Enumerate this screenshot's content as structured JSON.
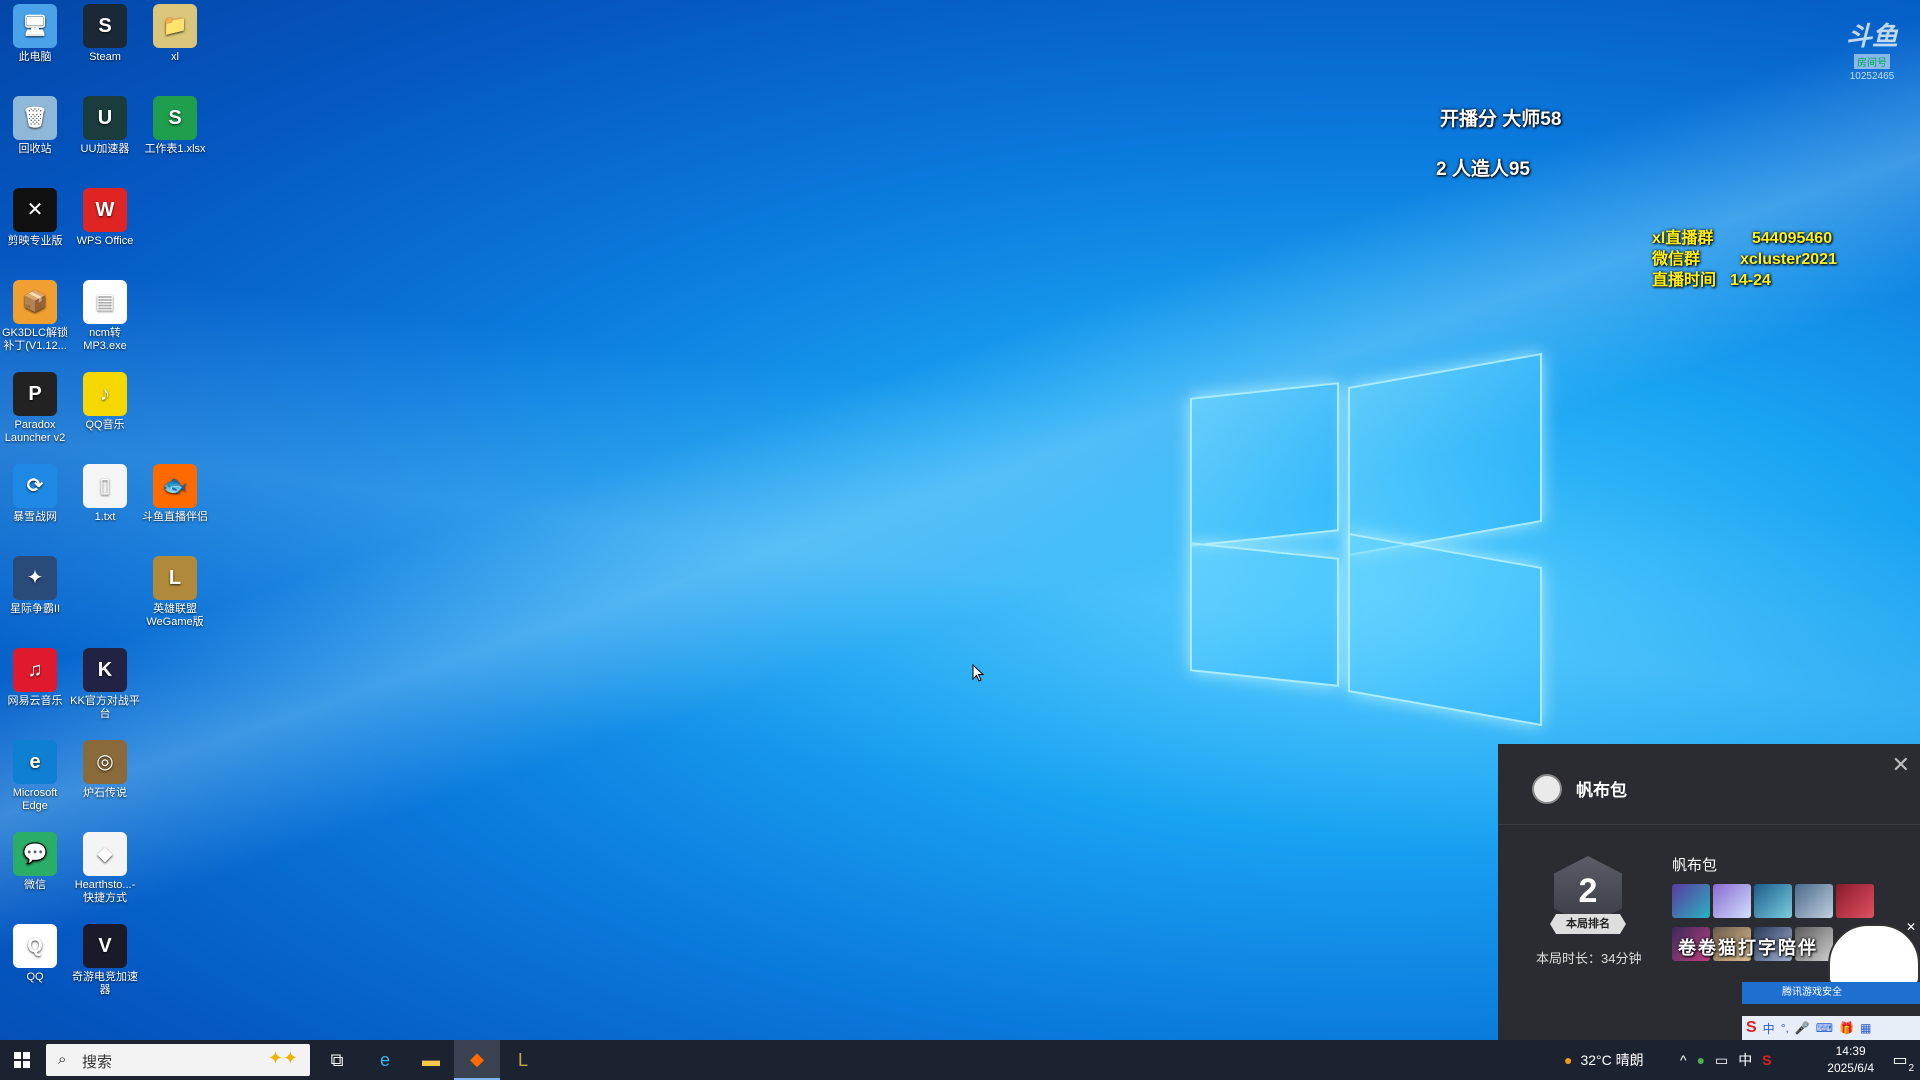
{
  "desktop_icons": [
    {
      "label": "此电脑",
      "glyph": "🖥",
      "color": "#4aa3e8"
    },
    {
      "label": "Steam",
      "glyph": "S",
      "color": "#1b2838"
    },
    {
      "label": "xl",
      "glyph": "📁",
      "color": "#d9c67a"
    },
    {
      "label": "回收站",
      "glyph": "🗑",
      "color": "#8fb8d8"
    },
    {
      "label": "UU加速器",
      "glyph": "U",
      "color": "#1a3c3c"
    },
    {
      "label": "工作表1.xlsx",
      "glyph": "S",
      "color": "#1f9e4e"
    },
    {
      "label": "剪映专业版",
      "glyph": "✕",
      "color": "#111111"
    },
    {
      "label": "WPS Office",
      "glyph": "W",
      "color": "#e02424"
    },
    {
      "label": "GK3DLC解锁补丁(V1.12...",
      "glyph": "📦",
      "color": "#f0a030"
    },
    {
      "label": "ncm转MP3.exe",
      "glyph": "▤",
      "color": "#ffffff"
    },
    {
      "label": "Paradox Launcher v2",
      "glyph": "P",
      "color": "#222222"
    },
    {
      "label": "QQ音乐",
      "glyph": "♪",
      "color": "#f5d800"
    },
    {
      "label": "暴雪战网",
      "glyph": "⟳",
      "color": "#1e88e5"
    },
    {
      "label": "1.txt",
      "glyph": "▯",
      "color": "#f5f5f5"
    },
    {
      "label": "斗鱼直播伴侣",
      "glyph": "🐟",
      "color": "#ff6a00"
    },
    {
      "label": "星际争霸II",
      "glyph": "✦",
      "color": "#2a4a7a"
    },
    {
      "label": "英雄联盟WeGame版",
      "glyph": "L",
      "color": "#b08a3a"
    },
    {
      "label": "网易云音乐",
      "glyph": "♫",
      "color": "#e0192c"
    },
    {
      "label": "KK官方对战平台",
      "glyph": "K",
      "color": "#222244"
    },
    {
      "label": "Microsoft Edge",
      "glyph": "e",
      "color": "#0f7fd1"
    },
    {
      "label": "炉石传说",
      "glyph": "◎",
      "color": "#8a6a3a"
    },
    {
      "label": "微信",
      "glyph": "💬",
      "color": "#2aae67"
    },
    {
      "label": "Hearthsto...- 快捷方式",
      "glyph": "◆",
      "color": "#f4f4f4"
    },
    {
      "label": "QQ",
      "glyph": "Q",
      "color": "#ffffff"
    },
    {
      "label": "奇游电竞加速器",
      "glyph": "V",
      "color": "#1a1a2a"
    }
  ],
  "overlay": {
    "line1": "开播分 大师58",
    "line2": "2 人造人95",
    "info": [
      {
        "key": "xl直播群",
        "value": "544095460"
      },
      {
        "key": "微信群",
        "value": "xcluster2021"
      },
      {
        "key": "直播时间",
        "value": "14-24"
      }
    ]
  },
  "watermark": {
    "brand": "斗鱼",
    "sub": "房间号",
    "room": "10252465"
  },
  "game_panel": {
    "title": "帆布包",
    "rank": "2",
    "rank_label": "本局排名",
    "duration": "本局时长：34分钟",
    "player_name": "帆布包",
    "scroll_text": "卷卷猫打字陪伴",
    "security_label": "腾讯游戏安全",
    "ime_labels": [
      "中",
      "中"
    ]
  },
  "taskbar": {
    "search_placeholder": "搜索",
    "weather": "32°C 晴朗",
    "ime": "中",
    "time": "14:39",
    "date": "2025/6/4",
    "notification_count": "2"
  },
  "colors": {
    "overlay_yellow": "#ffef1a",
    "panel_bg": "#2a2c31",
    "taskbar_bg": "#1c2330"
  }
}
